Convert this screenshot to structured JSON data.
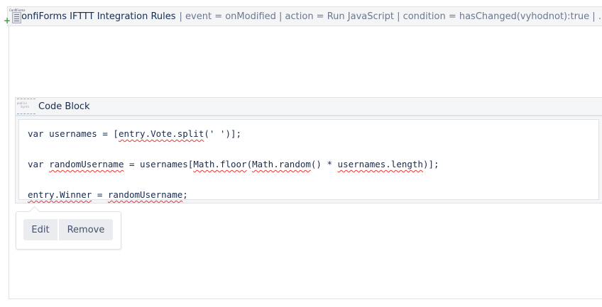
{
  "header": {
    "title": "ConfiForms IFTTT Integration Rules",
    "params": "| event = onModified | action = Run JavaScript | condition = hasChanged(vyhodnot):true | ...",
    "icon_label": "ConfiForms"
  },
  "code_block": {
    "title": "Code Block",
    "lines": [
      [
        {
          "t": "var usernames = [",
          "bad": false
        },
        {
          "t": "entry.Vote.split",
          "bad": true
        },
        {
          "t": "(' ')];",
          "bad": false
        }
      ],
      [],
      [
        {
          "t": "var ",
          "bad": false
        },
        {
          "t": "randomUsername",
          "bad": true
        },
        {
          "t": " = usernames[",
          "bad": false
        },
        {
          "t": "Math.floor",
          "bad": true
        },
        {
          "t": "(",
          "bad": false
        },
        {
          "t": "Math.random",
          "bad": true
        },
        {
          "t": "() * ",
          "bad": false
        },
        {
          "t": "usernames.length",
          "bad": true
        },
        {
          "t": ")];",
          "bad": false
        }
      ],
      [],
      [
        {
          "t": "entry.Winner",
          "bad": true
        },
        {
          "t": " = ",
          "bad": false
        },
        {
          "t": "randomUsername",
          "bad": true
        },
        {
          "t": ";",
          "bad": false
        }
      ]
    ]
  },
  "actions": {
    "edit": "Edit",
    "remove": "Remove"
  }
}
